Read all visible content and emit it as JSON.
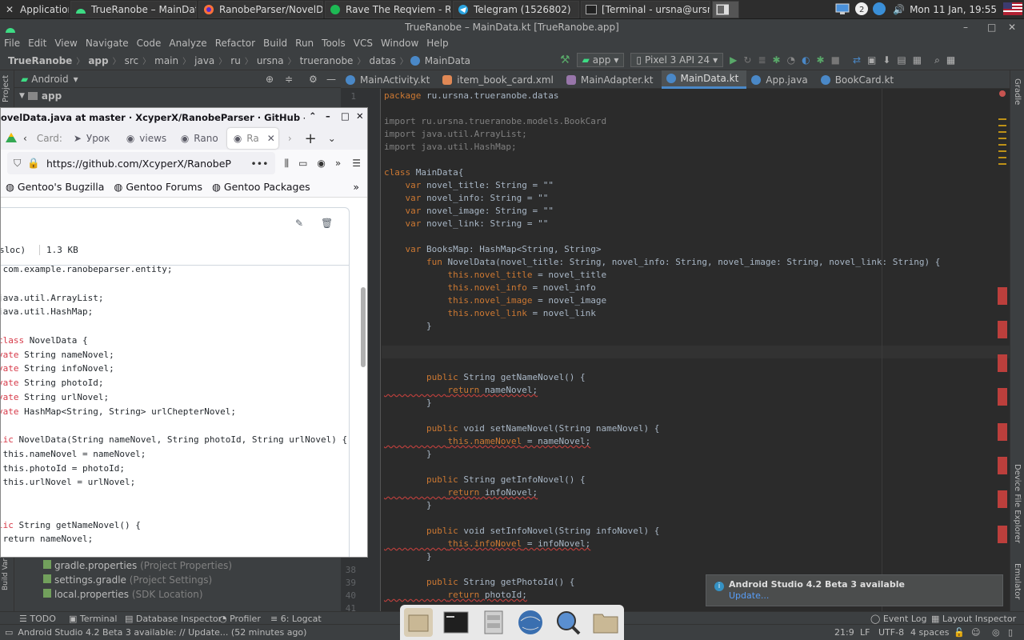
{
  "taskbar": {
    "apps_label": "Applications",
    "tasks": [
      {
        "label": "TrueRanobe – MainDat…",
        "icon": "android-icon",
        "color": "#3ddc84"
      },
      {
        "label": "RanobeParser/NovelD…",
        "icon": "firefox-icon",
        "color": "#ff7139"
      },
      {
        "label": "Rave The Reqviem - R…",
        "icon": "spotify-icon",
        "color": "#1db954"
      },
      {
        "label": "Telegram (1526802)",
        "icon": "telegram-icon",
        "color": "#2aa3df"
      },
      {
        "label": "[Terminal - ursna@ursn…",
        "icon": "terminal-icon",
        "color": "#555555"
      }
    ],
    "clock": "Mon 11 Jan, 19:55"
  },
  "ide": {
    "title": "TrueRanobe – MainData.kt [TrueRanobe.app]",
    "menu": [
      "File",
      "Edit",
      "View",
      "Navigate",
      "Code",
      "Analyze",
      "Refactor",
      "Build",
      "Run",
      "Tools",
      "VCS",
      "Window",
      "Help"
    ],
    "breadcrumbs": [
      "TrueRanobe",
      "app",
      "src",
      "main",
      "java",
      "ru",
      "ursna",
      "trueranobe",
      "datas",
      "MainData"
    ],
    "run_config": "app",
    "device": "Pixel 3 API 24",
    "project_view": "Android",
    "project_root": "app",
    "project_files": [
      {
        "name": "gradle.properties",
        "hint": "(Project Properties)"
      },
      {
        "name": "settings.gradle",
        "hint": "(Project Settings)"
      },
      {
        "name": "local.properties",
        "hint": "(SDK Location)"
      }
    ],
    "left_tool_labels": {
      "project": "Project",
      "build_variants": "Build Variants"
    },
    "right_tool_labels": {
      "gradle": "Gradle",
      "device_file_explorer": "Device File Explorer",
      "emulator": "Emulator"
    },
    "tabs": [
      {
        "label": "MainActivity.kt",
        "color": "#4a88c7"
      },
      {
        "label": "item_book_card.xml",
        "color": "#e08855"
      },
      {
        "label": "MainAdapter.kt",
        "color": "#9876aa"
      },
      {
        "label": "MainData.kt",
        "color": "#4a88c7",
        "active": true
      },
      {
        "label": "App.java",
        "color": "#4a88c7"
      },
      {
        "label": "BookCard.kt",
        "color": "#4a88c7"
      }
    ],
    "line_numbers_visible": [
      "1",
      "38",
      "39",
      "40",
      "41"
    ],
    "code_lines": [
      "package ru.ursna.trueranobe.datas",
      "",
      "import ru.ursna.trueranobe.models.BookCard",
      "import java.util.ArrayList;",
      "import java.util.HashMap;",
      "",
      "class MainData{",
      "    var novel_title: String = \"\"",
      "    var novel_info: String = \"\"",
      "    var novel_image: String = \"\"",
      "    var novel_link: String = \"\"",
      "",
      "    var BooksMap: HashMap<String, String>",
      "        fun NovelData(novel_title: String, novel_info: String, novel_image: String, novel_link: String) {",
      "            this.novel_title = novel_title",
      "            this.novel_info = novel_info",
      "            this.novel_image = novel_image",
      "            this.novel_link = novel_link",
      "        }",
      "",
      "",
      "",
      "        public String getNameNovel() {",
      "            return nameNovel;",
      "        }",
      "",
      "        public void setNameNovel(String nameNovel) {",
      "            this.nameNovel = nameNovel;",
      "        }",
      "",
      "        public String getInfoNovel() {",
      "            return infoNovel;",
      "        }",
      "",
      "        public void setInfoNovel(String infoNovel) {",
      "            this.infoNovel = infoNovel;",
      "        }",
      "",
      "        public String getPhotoId() {",
      "            return photoId;"
    ],
    "tool_windows": [
      "TODO",
      "Terminal",
      "Database Inspector",
      "Profiler",
      "6: Logcat"
    ],
    "tool_windows_right": [
      "Event Log",
      "Layout Inspector"
    ],
    "status_message": "Android Studio 4.2 Beta 3 available: // Update... (52 minutes ago)",
    "status_right": [
      "21:9",
      "LF",
      "UTF-8",
      "4 spaces"
    ]
  },
  "notification": {
    "title": "Android Studio 4.2 Beta 3 available",
    "link": "Update..."
  },
  "firefox": {
    "title": "ovelData.java at master · XcyperX/RanobeParser · GitHub — Mozilla Firefox",
    "tabs": [
      "Card:",
      "Урок",
      "views",
      "Rano",
      "Ra"
    ],
    "url": "https://github.com/XcyperX/RanobeP",
    "bookmarks": [
      "Gentoo's Bugzilla",
      "Gentoo Forums",
      "Gentoo Packages"
    ],
    "file_meta": [
      "sloc)",
      "1.3 KB"
    ],
    "code_lines": [
      " com.example.ranobeparser.entity;",
      "",
      "java.util.ArrayList;",
      "java.util.HashMap;",
      "",
      "class NovelData {",
      "vate String nameNovel;",
      "vate String infoNovel;",
      "vate String photoId;",
      "vate String urlNovel;",
      "vate HashMap<String, String> urlChepterNovel;",
      "",
      "lic NovelData(String nameNovel, String photoId, String urlNovel) {",
      " this.nameNovel = nameNovel;",
      " this.photoId = photoId;",
      " this.urlNovel = urlNovel;",
      "",
      "",
      "lic String getNameNovel() {",
      " return nameNovel;"
    ]
  }
}
